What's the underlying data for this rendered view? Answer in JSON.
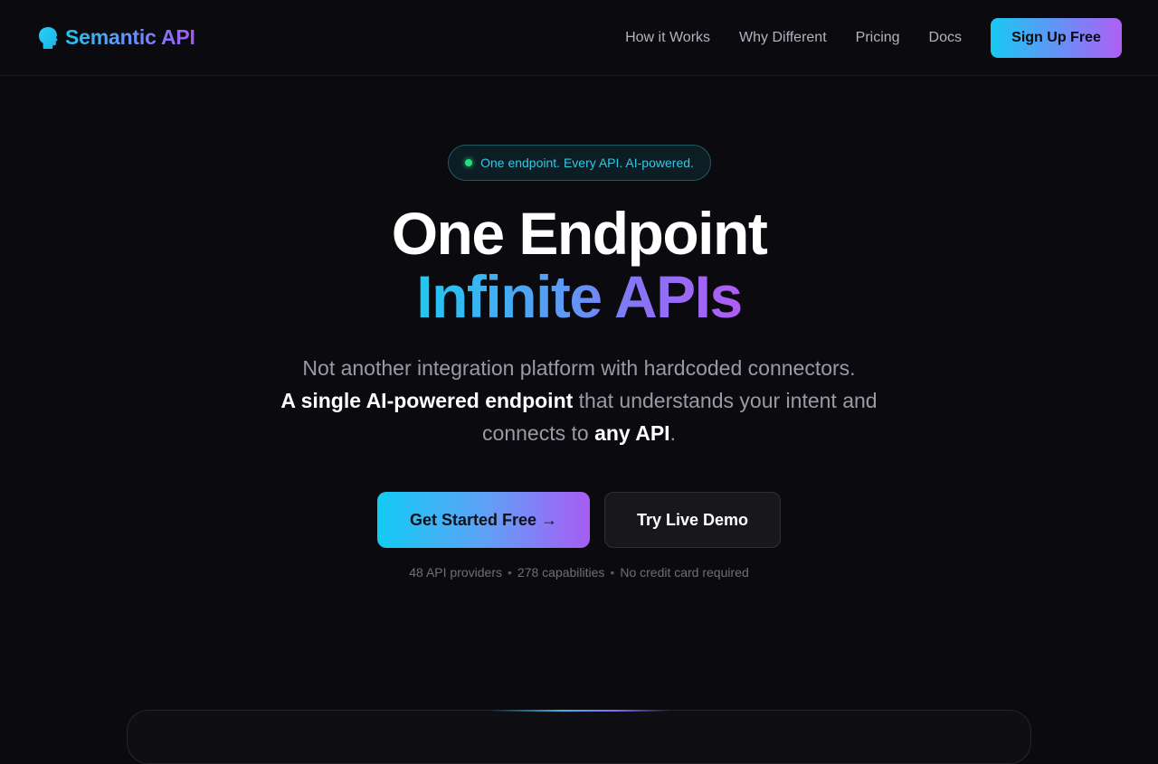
{
  "brand": {
    "name": "Semantic API",
    "icon": "head-icon"
  },
  "nav": {
    "links": [
      "How it Works",
      "Why Different",
      "Pricing",
      "Docs"
    ],
    "signup_label": "Sign Up Free"
  },
  "hero": {
    "badge": "One endpoint. Every API. AI-powered.",
    "headline_line1": "One Endpoint",
    "headline_line2": "Infinite APIs",
    "sub_line1": "Not another integration platform with hardcoded connectors.",
    "sub_bold1": "A single AI-powered endpoint",
    "sub_mid": " that understands your intent and connects to ",
    "sub_bold2": "any API",
    "sub_end": ".",
    "cta_primary": "Get Started Free →",
    "cta_secondary": "Try Live Demo",
    "meta": [
      "48 API providers",
      "278 capabilities",
      "No credit card required"
    ],
    "meta_separator": "•"
  },
  "colors": {
    "background": "#0b0b0f",
    "accent_start": "#19c9f2",
    "accent_end": "#b05ff5",
    "status_dot": "#22e07a"
  }
}
